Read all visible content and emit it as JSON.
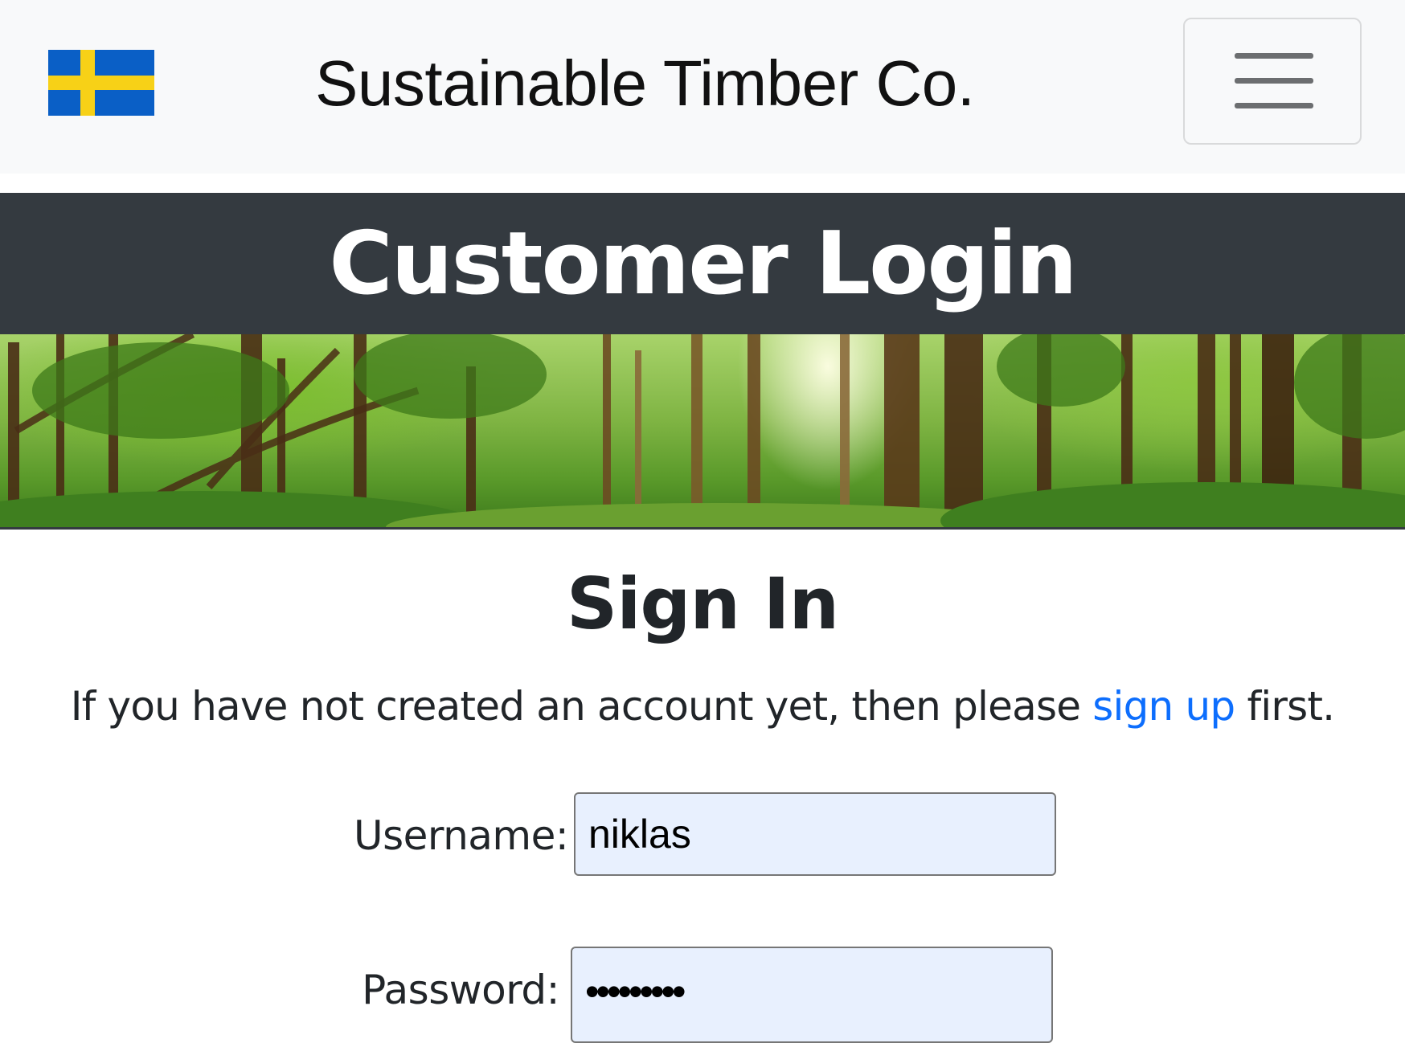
{
  "navbar": {
    "brand": "Sustainable Timber Co.",
    "flag_icon": "sweden-flag-icon",
    "menu_icon": "hamburger-menu-icon"
  },
  "banner": {
    "title": "Customer Login"
  },
  "forest_image": {
    "icon": "forest-banner-image"
  },
  "signin": {
    "title": "Sign In",
    "intro_before": "If you have not created an account yet, then please",
    "signup_link": "sign up",
    "intro_after": "first.",
    "username_label": "Username:",
    "username_value": "niklas",
    "password_label": "Password:",
    "password_value": "•••••••••"
  },
  "colors": {
    "navbar_bg": "#f8f9fa",
    "banner_bg": "#343a40",
    "link": "#0d6efd",
    "input_bg": "#e8f0fe",
    "flag_blue": "#0a5fc6",
    "flag_yellow": "#f7d117"
  }
}
